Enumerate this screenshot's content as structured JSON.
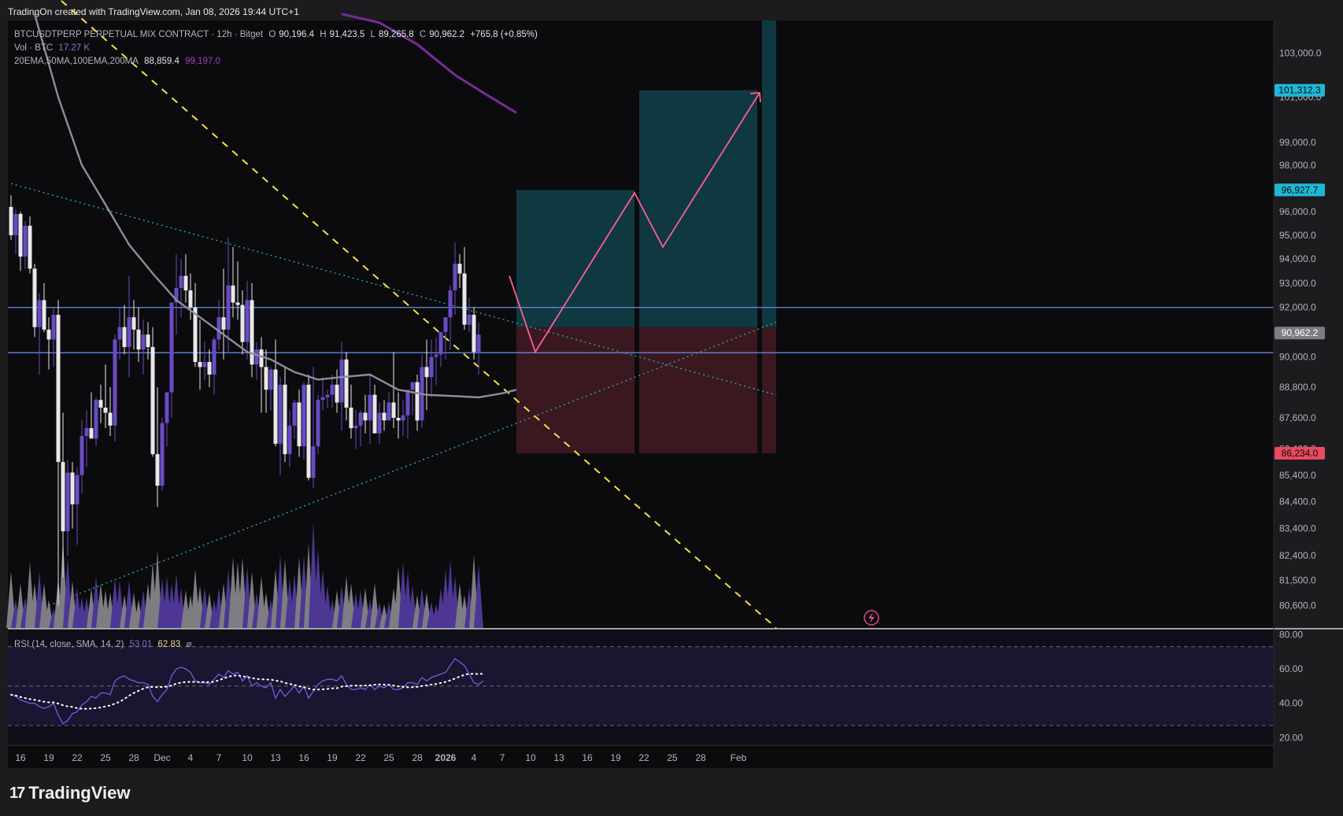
{
  "header": {
    "credit": "TradingOn created with TradingView.com, Jan 08, 2026 19:44 UTC+1"
  },
  "legend": {
    "symbol": "BTCUSDTPERP PERPETUAL MIX CONTRACT · 12h · Bitget",
    "o_label": "O",
    "o": "90,196.4",
    "h_label": "H",
    "h": "91,423.5",
    "l_label": "L",
    "l": "89,265.8",
    "c_label": "C",
    "c": "90,962.2",
    "change": "+765.8 (+0.85%)",
    "vol_label": "Vol · BTC",
    "vol": "17.27 K",
    "ma_label": "20EMA,50MA,100EMA,200MA",
    "ma1": "88,859.4",
    "ma2": "99,197.0",
    "rsi_label": "RSI (14, close, SMA, 14, 2)",
    "rsi1": "53.01",
    "rsi2": "62.83",
    "rsi3": "⌀"
  },
  "brand": {
    "name": "TradingView",
    "logo": "17"
  },
  "colors": {
    "bg": "#0c0c0e",
    "up": "#6a4bc4",
    "down": "#e8e8ec",
    "ma50": "#8e8e95",
    "ma200": "#7a2a9a",
    "hline": "#6c8fe8",
    "target": "#1fb8d4",
    "stop": "#e84a5f",
    "path": "#ff5c9a",
    "trend": "#f4e14a"
  },
  "chart_data": {
    "type": "candlestick",
    "symbol": "BTCUSDTPERP",
    "timeframe": "12h",
    "price_scale": {
      "log": true,
      "range": [
        79800,
        104500
      ],
      "ticks": [
        103000,
        101000,
        99000,
        98000,
        96000,
        95000,
        94000,
        93000,
        92000,
        90000,
        88800,
        87600,
        86400,
        85400,
        84400,
        83400,
        82400,
        81500,
        80600
      ],
      "tick_labels": [
        "103,000.0",
        "101,000.0",
        "99,000.0",
        "98,000.0",
        "96,000.0",
        "95,000.0",
        "94,000.0",
        "93,000.0",
        "92,000.0",
        "90,000.0",
        "88,800.0",
        "87,600.0",
        "86,400.0",
        "85,400.0",
        "84,400.0",
        "83,400.0",
        "82,400.0",
        "81,500.0",
        "80,600.0"
      ]
    },
    "price_badges": [
      {
        "value": 101312.3,
        "label": "101,312.3",
        "kind": "target"
      },
      {
        "value": 96927.7,
        "label": "96,927.7",
        "kind": "target"
      },
      {
        "value": 90962.2,
        "label": "90,962.2",
        "kind": "last"
      },
      {
        "value": 86234.0,
        "label": "86,234.0",
        "kind": "stop"
      }
    ],
    "x_ticks": [
      {
        "bar": 2,
        "label": "16"
      },
      {
        "bar": 8,
        "label": "19"
      },
      {
        "bar": 14,
        "label": "22"
      },
      {
        "bar": 20,
        "label": "25"
      },
      {
        "bar": 26,
        "label": "28"
      },
      {
        "bar": 32,
        "label": "Dec"
      },
      {
        "bar": 38,
        "label": "4"
      },
      {
        "bar": 44,
        "label": "7"
      },
      {
        "bar": 50,
        "label": "10"
      },
      {
        "bar": 56,
        "label": "13"
      },
      {
        "bar": 62,
        "label": "16"
      },
      {
        "bar": 68,
        "label": "19"
      },
      {
        "bar": 74,
        "label": "22"
      },
      {
        "bar": 80,
        "label": "25"
      },
      {
        "bar": 86,
        "label": "28"
      },
      {
        "bar": 92,
        "label": "2026"
      },
      {
        "bar": 98,
        "label": "4"
      },
      {
        "bar": 104,
        "label": "7"
      },
      {
        "bar": 110,
        "label": "10"
      },
      {
        "bar": 116,
        "label": "13"
      },
      {
        "bar": 122,
        "label": "16"
      },
      {
        "bar": 128,
        "label": "19"
      },
      {
        "bar": 134,
        "label": "22"
      },
      {
        "bar": 140,
        "label": "25"
      },
      {
        "bar": 146,
        "label": "28"
      },
      {
        "bar": 154,
        "label": "Feb"
      }
    ],
    "candles_ohlc": [
      [
        96200,
        96700,
        94800,
        95000
      ],
      [
        95000,
        96100,
        94200,
        95900
      ],
      [
        95900,
        96000,
        93500,
        94100
      ],
      [
        94100,
        95600,
        93600,
        95400
      ],
      [
        95400,
        95800,
        93400,
        93600
      ],
      [
        93600,
        93800,
        90800,
        91200
      ],
      [
        91200,
        92600,
        89300,
        92300
      ],
      [
        92300,
        93000,
        91000,
        91100
      ],
      [
        91100,
        91600,
        89500,
        90700
      ],
      [
        90700,
        92000,
        89600,
        91700
      ],
      [
        91700,
        92300,
        80600,
        85900
      ],
      [
        85900,
        87800,
        81600,
        83300
      ],
      [
        83300,
        86000,
        82400,
        85500
      ],
      [
        85500,
        85900,
        83400,
        84300
      ],
      [
        84300,
        85700,
        82800,
        85400
      ],
      [
        85400,
        87500,
        84700,
        86900
      ],
      [
        86900,
        87900,
        85700,
        87200
      ],
      [
        87200,
        88600,
        86800,
        86800
      ],
      [
        86800,
        88400,
        86500,
        88300
      ],
      [
        88300,
        88900,
        87400,
        88000
      ],
      [
        88000,
        89700,
        87200,
        87800
      ],
      [
        87800,
        88800,
        86900,
        87300
      ],
      [
        87300,
        90900,
        86700,
        90700
      ],
      [
        90700,
        92000,
        89900,
        91200
      ],
      [
        91200,
        92100,
        90100,
        90400
      ],
      [
        90400,
        93300,
        89200,
        91600
      ],
      [
        91600,
        92300,
        90300,
        91100
      ],
      [
        91100,
        92000,
        89800,
        90300
      ],
      [
        90300,
        91500,
        89300,
        90900
      ],
      [
        90900,
        91400,
        89900,
        90400
      ],
      [
        90400,
        91200,
        86100,
        86200
      ],
      [
        86200,
        88800,
        84200,
        85000
      ],
      [
        85000,
        87600,
        84800,
        87400
      ],
      [
        87400,
        88500,
        86500,
        88600
      ],
      [
        88600,
        92000,
        87600,
        92200
      ],
      [
        92200,
        94200,
        90900,
        92800
      ],
      [
        92800,
        94000,
        91600,
        93300
      ],
      [
        93300,
        94200,
        92200,
        92700
      ],
      [
        92700,
        93400,
        91500,
        92000
      ],
      [
        92000,
        93000,
        89600,
        89800
      ],
      [
        89800,
        91500,
        88700,
        89600
      ],
      [
        89600,
        90600,
        89100,
        89800
      ],
      [
        89800,
        90300,
        88800,
        89300
      ],
      [
        89300,
        90800,
        88500,
        90700
      ],
      [
        90700,
        92300,
        90300,
        91600
      ],
      [
        91600,
        93600,
        89900,
        91100
      ],
      [
        91100,
        94900,
        90200,
        92900
      ],
      [
        92900,
        94500,
        91600,
        92200
      ],
      [
        92200,
        93900,
        91500,
        92100
      ],
      [
        92100,
        92700,
        90100,
        90600
      ],
      [
        90600,
        93100,
        89900,
        92300
      ],
      [
        92300,
        93000,
        89200,
        89700
      ],
      [
        89700,
        90600,
        89100,
        90300
      ],
      [
        90300,
        90800,
        87800,
        89600
      ],
      [
        89600,
        90300,
        87800,
        88700
      ],
      [
        88700,
        89600,
        87900,
        89500
      ],
      [
        89500,
        90700,
        86500,
        86600
      ],
      [
        86600,
        89200,
        85400,
        88900
      ],
      [
        88900,
        89600,
        85900,
        86200
      ],
      [
        86200,
        87900,
        85700,
        87300
      ],
      [
        87300,
        88300,
        86800,
        88200
      ],
      [
        88200,
        88700,
        86100,
        86500
      ],
      [
        86500,
        89000,
        86000,
        88900
      ],
      [
        88900,
        89300,
        85200,
        85300
      ],
      [
        85300,
        89600,
        84900,
        86500
      ],
      [
        86500,
        88500,
        86200,
        88300
      ],
      [
        88300,
        89200,
        87900,
        88400
      ],
      [
        88400,
        88700,
        88000,
        88500
      ],
      [
        88500,
        89300,
        88000,
        88900
      ],
      [
        88900,
        89500,
        87800,
        88200
      ],
      [
        88200,
        90600,
        87100,
        89900
      ],
      [
        89900,
        90200,
        87500,
        88000
      ],
      [
        88000,
        88900,
        86800,
        87200
      ],
      [
        87200,
        87900,
        86400,
        87300
      ],
      [
        87300,
        87900,
        86500,
        87800
      ],
      [
        87800,
        88500,
        87000,
        87500
      ],
      [
        87500,
        89300,
        86600,
        88500
      ],
      [
        88500,
        88900,
        87100,
        87000
      ],
      [
        87000,
        88200,
        86600,
        87800
      ],
      [
        87800,
        88300,
        87100,
        87500
      ],
      [
        87500,
        88600,
        87500,
        88200
      ],
      [
        88200,
        90200,
        87200,
        87600
      ],
      [
        87600,
        88600,
        86800,
        87500
      ],
      [
        87500,
        88300,
        86900,
        87700
      ],
      [
        87700,
        88200,
        86800,
        88700
      ],
      [
        88700,
        89000,
        87700,
        89000
      ],
      [
        89000,
        89300,
        87100,
        87500
      ],
      [
        87500,
        90100,
        87200,
        89600
      ],
      [
        89600,
        90700,
        87900,
        89200
      ],
      [
        89200,
        90700,
        88400,
        90000
      ],
      [
        90000,
        90800,
        88900,
        90100
      ],
      [
        90100,
        91000,
        89600,
        91000
      ],
      [
        91000,
        91400,
        89900,
        91600
      ],
      [
        91600,
        92900,
        90300,
        92700
      ],
      [
        92700,
        94700,
        91700,
        93800
      ],
      [
        93800,
        94200,
        92800,
        93400
      ],
      [
        93400,
        94500,
        91100,
        91300
      ],
      [
        91300,
        92400,
        91000,
        91700
      ],
      [
        91700,
        92000,
        89900,
        90200
      ],
      [
        90200,
        91400,
        89300,
        90900
      ]
    ],
    "volume_rel": [
      0.48,
      0.24,
      0.38,
      0.26,
      0.56,
      0.38,
      0.48,
      0.38,
      0.24,
      0.16,
      0.42,
      0.75,
      0.6,
      0.4,
      0.34,
      0.26,
      0.26,
      0.34,
      0.44,
      0.38,
      0.32,
      0.3,
      0.42,
      0.4,
      0.28,
      0.4,
      0.3,
      0.24,
      0.32,
      0.38,
      0.56,
      0.66,
      0.42,
      0.44,
      0.38,
      0.46,
      0.34,
      0.32,
      0.28,
      0.5,
      0.36,
      0.34,
      0.3,
      0.24,
      0.34,
      0.38,
      0.5,
      0.6,
      0.56,
      0.6,
      0.52,
      0.48,
      0.3,
      0.44,
      0.3,
      0.24,
      0.5,
      0.62,
      0.58,
      0.42,
      0.46,
      0.6,
      0.62,
      0.72,
      0.9,
      0.68,
      0.5,
      0.36,
      0.24,
      0.32,
      0.36,
      0.44,
      0.38,
      0.3,
      0.32,
      0.34,
      0.24,
      0.38,
      0.22,
      0.2,
      0.22,
      0.34,
      0.52,
      0.56,
      0.48,
      0.36,
      0.28,
      0.34,
      0.3,
      0.22,
      0.2,
      0.34,
      0.5,
      0.58,
      0.44,
      0.38,
      0.28,
      0.34,
      0.62,
      0.54,
      0.4,
      0.26
    ],
    "rsi": [
      45,
      44,
      42,
      41,
      40,
      40,
      38,
      37,
      38,
      40,
      33,
      28,
      30,
      34,
      35,
      39,
      41,
      44,
      43,
      46,
      46,
      45,
      53,
      55,
      56,
      54,
      53,
      52,
      52,
      51,
      44,
      41,
      45,
      48,
      56,
      60,
      61,
      60,
      58,
      53,
      52,
      52,
      51,
      54,
      57,
      55,
      59,
      57,
      58,
      53,
      56,
      50,
      52,
      50,
      49,
      52,
      43,
      48,
      44,
      47,
      50,
      46,
      50,
      43,
      47,
      51,
      53,
      54,
      54,
      53,
      56,
      51,
      48,
      48,
      49,
      48,
      51,
      48,
      50,
      49,
      51,
      48,
      48,
      49,
      52,
      52,
      51,
      55,
      53,
      55,
      56,
      57,
      58,
      62,
      66,
      64,
      62,
      57,
      52,
      51,
      53
    ],
    "rsi_scale": {
      "range": [
        16,
        83
      ],
      "ticks": [
        80,
        60,
        40,
        20
      ],
      "tick_labels": [
        "80.00",
        "60.00",
        "40.00",
        "20.00"
      ],
      "bands": [
        73,
        50,
        27
      ]
    },
    "ma50": [
      [
        5,
        104800
      ],
      [
        10,
        101000
      ],
      [
        15,
        98000
      ],
      [
        20,
        96300
      ],
      [
        25,
        94600
      ],
      [
        30,
        93400
      ],
      [
        35,
        92300
      ],
      [
        40,
        91600
      ],
      [
        45,
        90900
      ],
      [
        50,
        90200
      ],
      [
        55,
        89900
      ],
      [
        60,
        89400
      ],
      [
        65,
        89100
      ],
      [
        70,
        89200
      ],
      [
        76,
        89300
      ],
      [
        82,
        88700
      ],
      [
        88,
        88500
      ],
      [
        94,
        88450
      ],
      [
        99,
        88400
      ],
      [
        104,
        88560
      ],
      [
        107,
        88700
      ]
    ],
    "ma200": [
      [
        70,
        104800
      ],
      [
        78,
        104400
      ],
      [
        86,
        103400
      ],
      [
        94,
        102000
      ],
      [
        100,
        101200
      ],
      [
        107,
        100300
      ]
    ],
    "horizontal_levels": [
      92000,
      90170
    ],
    "trendlines": [
      {
        "style": "dashed",
        "color": "trend",
        "from": [
          0,
          107500
        ],
        "to": [
          162,
          79800
        ]
      },
      {
        "style": "dotted",
        "color": "teal",
        "from": [
          0,
          97200
        ],
        "to": [
          162,
          88500
        ]
      },
      {
        "style": "dotted",
        "color": "teal",
        "from": [
          8,
          80600
        ],
        "to": [
          162,
          91400
        ]
      }
    ],
    "positions": [
      {
        "from": 107,
        "to": 132,
        "entry": 91200,
        "target": 96927.7,
        "stop": 86234.0
      },
      {
        "from": 133,
        "to": 158,
        "entry": 91200,
        "target": 101312.3,
        "stop": 86234.0
      },
      {
        "from": 159,
        "to": 162,
        "entry": 91200,
        "target": 104500,
        "stop": 86234.0
      }
    ],
    "projection_path": [
      [
        105.5,
        93300
      ],
      [
        111,
        90200
      ],
      [
        132,
        96800
      ],
      [
        138,
        94500
      ],
      [
        158.5,
        101200
      ]
    ]
  }
}
